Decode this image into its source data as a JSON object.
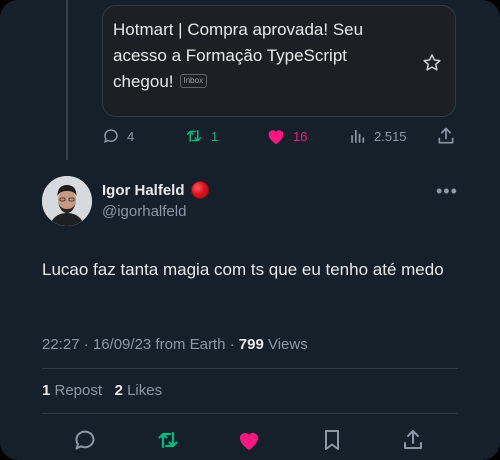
{
  "quoted": {
    "text": "Hotmart | Compra aprovada! Seu acesso a Formação TypeScript chegou!",
    "badge": "Inbox"
  },
  "prev_actions": {
    "replies": "4",
    "reposts": "1",
    "likes": "16",
    "views": "2.515"
  },
  "author": {
    "name": "Igor Halfeld",
    "handle": "@igorhalfeld"
  },
  "tweet": {
    "text": "Lucao faz tanta magia com ts que eu tenho até medo",
    "time": "22:27 · 16/09/23 from Earth · ",
    "views_count": "799",
    "views_label": " Views"
  },
  "stats": {
    "reposts_count": "1",
    "reposts_label": " Repost",
    "likes_count": "2",
    "likes_label": " Likes"
  },
  "colors": {
    "background": "#15202b",
    "like_pink": "#f91880",
    "repost_green": "#00ba7c",
    "muted": "#8b98a5"
  }
}
